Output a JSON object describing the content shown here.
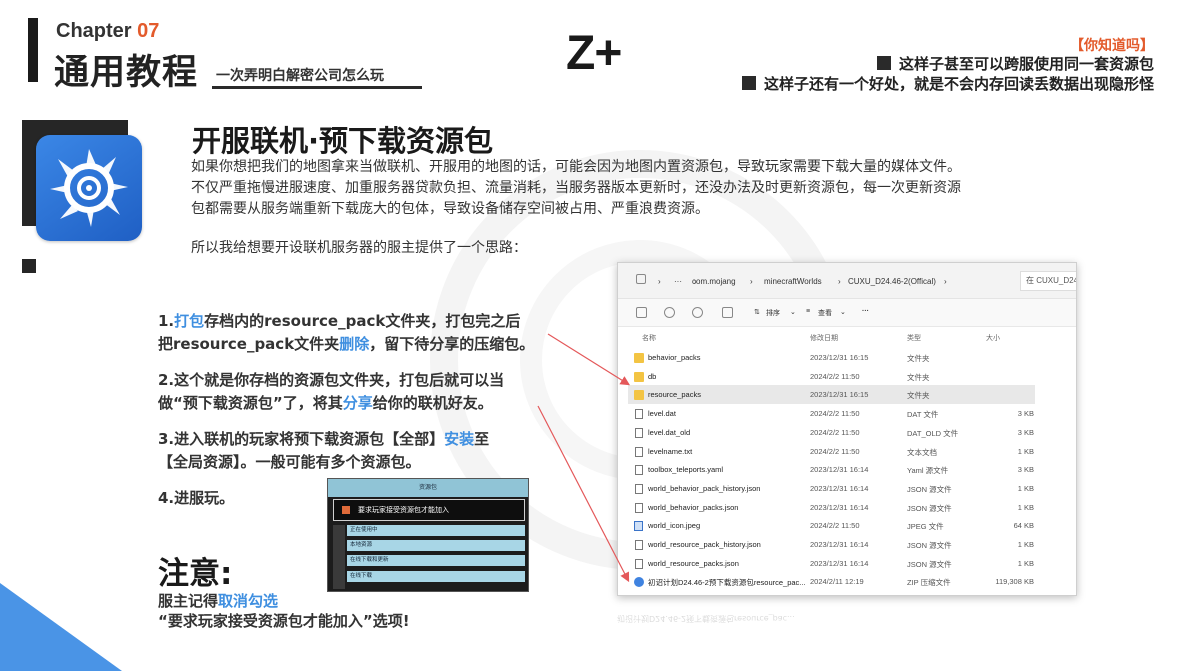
{
  "header": {
    "chapter_label": "Chapter",
    "chapter_num": "07",
    "title": "通用教程",
    "subtitle": "一次弄明白解密公司怎么玩",
    "logo": "Z+"
  },
  "did_you_know": {
    "tag": "【你知道吗】",
    "line1": "这样子甚至可以跨服使用同一套资源包",
    "line2": "这样子还有一个好处，就是不会内存回读丢数据出现隐形怪"
  },
  "section": {
    "title": "开服联机·预下载资源包",
    "para1": "如果你想把我们的地图拿来当做联机、开服用的地图的话，可能会因为地图内置资源包，导致玩家需要下载大量的媒体文件。",
    "para2": "不仅严重拖慢进服速度、加重服务器贷款负担、流量消耗，当服务器版本更新时，还没办法及时更新资源包，每一次更新资源",
    "para3": "包都需要从服务端重新下载庞大的包体，导致设备储存空间被占用、严重浪费资源。",
    "para4": "所以我给想要开设联机服务器的服主提供了一个思路："
  },
  "steps": {
    "s1_a": "1.",
    "s1_b": "打包",
    "s1_c": "存档内的resource_pack文件夹，打包完之后",
    "s1_d": "把resource_pack文件夹",
    "s1_e": "删除",
    "s1_f": "，留下待分享的压缩包。",
    "s2_a": "2.这个就是你存档的资源包文件夹，打包后就可以当",
    "s2_b": "做“预下载资源包”了，将其",
    "s2_c": "分享",
    "s2_d": "给你的联机好友。",
    "s3_a": "3.进入联机的玩家将预下载资源包【全部】",
    "s3_b": "安装",
    "s3_c": "至",
    "s3_d": "【全局资源】。一般可能有多个资源包。",
    "s4": "4.进服玩。"
  },
  "note": {
    "title": "注意:",
    "line1_a": "服主记得",
    "line1_b": "取消勾选",
    "line2": "“要求玩家接受资源包才能加入”选项!"
  },
  "mc_dialog": {
    "header": "资源包",
    "option": "要求玩家接受资源包才能加入",
    "row1": "正在使用中",
    "row2": "本地资源",
    "row3": "在线下载和更新",
    "row4": "在线下载"
  },
  "explorer": {
    "crumbs": [
      "···",
      "com.mojang",
      "minecraftWorlds",
      "CUXU_D24.46-2(Offical)"
    ],
    "search_placeholder": "在 CUXU_D24",
    "toolbar": {
      "sort": "排序",
      "view": "查看",
      "more": "···"
    },
    "columns": {
      "name": "名称",
      "date": "修改日期",
      "type": "类型",
      "size": "大小"
    },
    "rows": [
      {
        "name": "behavior_packs",
        "date": "2023/12/31 16:15",
        "type": "文件夹",
        "size": "",
        "icon": "folder"
      },
      {
        "name": "db",
        "date": "2024/2/2 11:50",
        "type": "文件夹",
        "size": "",
        "icon": "folder"
      },
      {
        "name": "resource_packs",
        "date": "2023/12/31 16:15",
        "type": "文件夹",
        "size": "",
        "icon": "folder"
      },
      {
        "name": "level.dat",
        "date": "2024/2/2 11:50",
        "type": "DAT 文件",
        "size": "3 KB",
        "icon": "file"
      },
      {
        "name": "level.dat_old",
        "date": "2024/2/2 11:50",
        "type": "DAT_OLD 文件",
        "size": "3 KB",
        "icon": "file"
      },
      {
        "name": "levelname.txt",
        "date": "2024/2/2 11:50",
        "type": "文本文档",
        "size": "1 KB",
        "icon": "file"
      },
      {
        "name": "toolbox_teleports.yaml",
        "date": "2023/12/31 16:14",
        "type": "Yaml 源文件",
        "size": "3 KB",
        "icon": "file"
      },
      {
        "name": "world_behavior_pack_history.json",
        "date": "2023/12/31 16:14",
        "type": "JSON 源文件",
        "size": "1 KB",
        "icon": "file"
      },
      {
        "name": "world_behavior_packs.json",
        "date": "2023/12/31 16:14",
        "type": "JSON 源文件",
        "size": "1 KB",
        "icon": "file"
      },
      {
        "name": "world_icon.jpeg",
        "date": "2024/2/2 11:50",
        "type": "JPEG 文件",
        "size": "64 KB",
        "icon": "img"
      },
      {
        "name": "world_resource_pack_history.json",
        "date": "2023/12/31 16:14",
        "type": "JSON 源文件",
        "size": "1 KB",
        "icon": "file"
      },
      {
        "name": "world_resource_packs.json",
        "date": "2023/12/31 16:14",
        "type": "JSON 源文件",
        "size": "1 KB",
        "icon": "file"
      },
      {
        "name": "初诏计划D24.46-2预下载资源包resource_pac...",
        "date": "2024/2/11 12:19",
        "type": "ZIP 压缩文件",
        "size": "119,308 KB",
        "icon": "zip"
      }
    ],
    "selected_row": 2
  },
  "colors": {
    "accent_orange": "#e35b2c",
    "accent_blue": "#3f8fe0",
    "arrow": "#e4585a"
  }
}
